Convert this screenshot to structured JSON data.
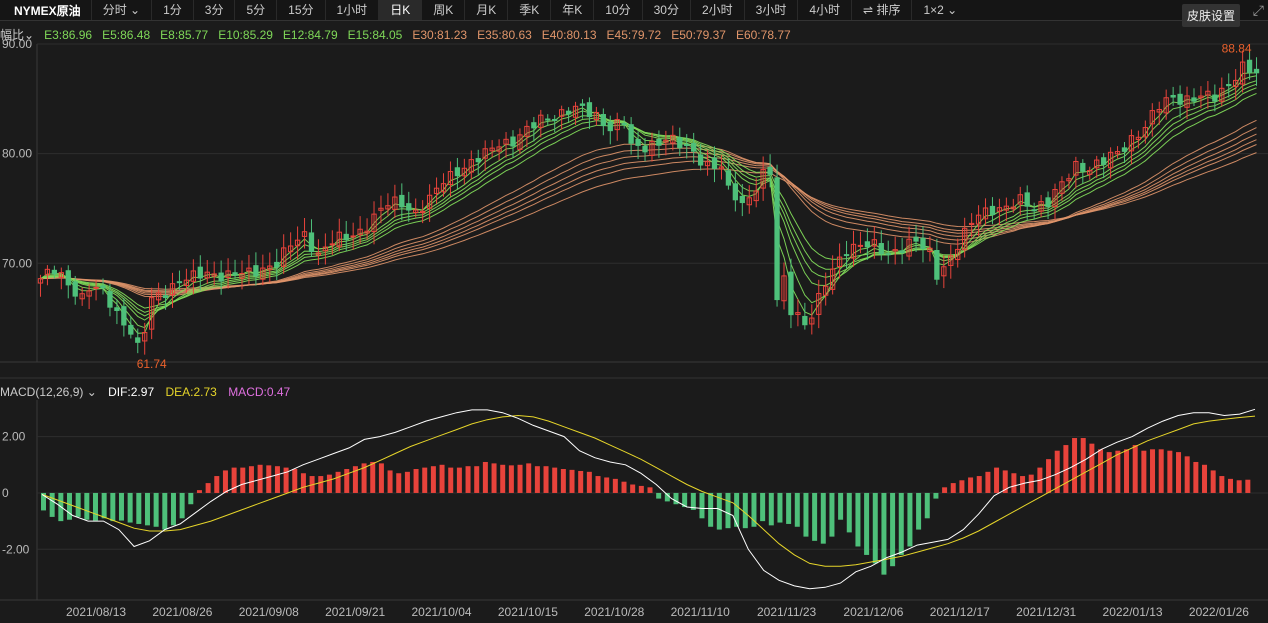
{
  "toolbar": {
    "symbol": "NYMEX原油",
    "timeshare": "分时 ⌄",
    "tabs": [
      "1分",
      "3分",
      "5分",
      "15分",
      "1小时",
      "日K",
      "周K",
      "月K",
      "季K",
      "年K",
      "10分",
      "30分",
      "2小时",
      "3小时",
      "4小时"
    ],
    "active": "日K",
    "sort": "排序",
    "layout": "1×2 ⌄",
    "skin": "皮肤设置"
  },
  "ema_legend": {
    "prefix": "幅比⌄",
    "items": [
      {
        "label": "E3:86.96",
        "color": "#7fd858"
      },
      {
        "label": "E5:86.48",
        "color": "#7fd858"
      },
      {
        "label": "E8:85.77",
        "color": "#7fd858"
      },
      {
        "label": "E10:85.29",
        "color": "#7fd858"
      },
      {
        "label": "E12:84.79",
        "color": "#7fd858"
      },
      {
        "label": "E15:84.05",
        "color": "#7fd858"
      },
      {
        "label": "E30:81.23",
        "color": "#e0956a"
      },
      {
        "label": "E35:80.63",
        "color": "#e0956a"
      },
      {
        "label": "E40:80.13",
        "color": "#e0956a"
      },
      {
        "label": "E45:79.72",
        "color": "#e0956a"
      },
      {
        "label": "E50:79.37",
        "color": "#e0956a"
      },
      {
        "label": "E60:78.77",
        "color": "#e0956a"
      }
    ]
  },
  "macd_legend": {
    "title": "MACD(12,26,9) ⌄",
    "dif": "DIF:2.97",
    "dea": "DEA:2.73",
    "macd": "MACD:0.47"
  },
  "colors": {
    "up": "#e8433b",
    "down": "#4ec07a",
    "dif": "#ffffff",
    "dea": "#e6d52a",
    "grid": "#2e2e2e",
    "annot": "#e8602c",
    "fast": "#7fd858",
    "slow": "#e0956a"
  },
  "chart_data": [
    {
      "type": "candlestick",
      "ylim": [
        61,
        90
      ],
      "yticks": [
        70,
        80,
        90
      ],
      "ytick_labels": [
        "70.00",
        "80.00",
        "90.00"
      ],
      "annotations": [
        {
          "text": "61.74",
          "value": 61.74,
          "at": "low"
        },
        {
          "text": "88.84",
          "value": 88.84,
          "at": "high"
        }
      ],
      "dates": [
        "2021/08/13",
        "2021/08/26",
        "2021/09/08",
        "2021/09/21",
        "2021/10/04",
        "2021/10/15",
        "2021/10/28",
        "2021/11/10",
        "2021/11/23",
        "2021/12/06",
        "2021/12/17",
        "2021/12/31",
        "2022/01/13",
        "2022/01/26"
      ],
      "close_path": [
        [
          0,
          68.6
        ],
        [
          2,
          69.2
        ],
        [
          4,
          68.2
        ],
        [
          6,
          67.0
        ],
        [
          7,
          67.8
        ],
        [
          9,
          67.2
        ],
        [
          11,
          65.5
        ],
        [
          13,
          64.0
        ],
        [
          14,
          62.3
        ],
        [
          15,
          63.8
        ],
        [
          16,
          66.5
        ],
        [
          18,
          67.5
        ],
        [
          20,
          68.6
        ],
        [
          22,
          68.6
        ],
        [
          24,
          69.0
        ],
        [
          26,
          69.1
        ],
        [
          28,
          69.0
        ],
        [
          30,
          68.9
        ],
        [
          32,
          69.6
        ],
        [
          34,
          70.2
        ],
        [
          36,
          71.5
        ],
        [
          38,
          72.5
        ],
        [
          40,
          71.0
        ],
        [
          42,
          72.0
        ],
        [
          44,
          72.2
        ],
        [
          46,
          73.0
        ],
        [
          48,
          74.3
        ],
        [
          50,
          75.3
        ],
        [
          52,
          75.5
        ],
        [
          54,
          74.8
        ],
        [
          56,
          75.7
        ],
        [
          58,
          77.4
        ],
        [
          60,
          78.6
        ],
        [
          62,
          79.2
        ],
        [
          64,
          79.8
        ],
        [
          66,
          81.0
        ],
        [
          68,
          81.3
        ],
        [
          70,
          82.0
        ],
        [
          72,
          83.0
        ],
        [
          74,
          83.6
        ],
        [
          76,
          84.0
        ],
        [
          78,
          83.9
        ],
        [
          80,
          83.5
        ],
        [
          82,
          82.5
        ],
        [
          84,
          82.8
        ],
        [
          85,
          80.5
        ],
        [
          86,
          80.5
        ],
        [
          88,
          81.0
        ],
        [
          90,
          81.3
        ],
        [
          92,
          80.7
        ],
        [
          94,
          80.3
        ],
        [
          96,
          79.0
        ],
        [
          98,
          78.6
        ],
        [
          99,
          76.5
        ],
        [
          100,
          76.2
        ],
        [
          101,
          75.5
        ],
        [
          102,
          76.2
        ],
        [
          104,
          78.0
        ],
        [
          105,
          78.1
        ],
        [
          106,
          66.5
        ],
        [
          107,
          68.5
        ],
        [
          108,
          66.0
        ],
        [
          109,
          65.5
        ],
        [
          110,
          64.5
        ],
        [
          111,
          65.2
        ],
        [
          112,
          66.5
        ],
        [
          114,
          69.5
        ],
        [
          116,
          71.5
        ],
        [
          118,
          71.5
        ],
        [
          120,
          71.5
        ],
        [
          122,
          71.0
        ],
        [
          124,
          71.5
        ],
        [
          126,
          71.8
        ],
        [
          128,
          71.0
        ],
        [
          129,
          69.2
        ],
        [
          131,
          70.5
        ],
        [
          133,
          72.5
        ],
        [
          135,
          74.7
        ],
        [
          137,
          75.1
        ],
        [
          139,
          74.8
        ],
        [
          141,
          75.7
        ],
        [
          143,
          75.3
        ],
        [
          145,
          75.6
        ],
        [
          147,
          77.0
        ],
        [
          149,
          79.0
        ],
        [
          151,
          78.8
        ],
        [
          153,
          79.2
        ],
        [
          155,
          80.0
        ],
        [
          157,
          81.5
        ],
        [
          159,
          82.4
        ],
        [
          161,
          84.2
        ],
        [
          163,
          85.3
        ],
        [
          165,
          85.0
        ],
        [
          167,
          85.0
        ],
        [
          169,
          85.2
        ],
        [
          171,
          86.5
        ],
        [
          173,
          87.8
        ],
        [
          175,
          87.1
        ]
      ],
      "ema_fast_last": [
        86.96,
        86.48,
        85.77,
        85.29,
        84.79,
        84.05
      ],
      "ema_slow_last": [
        81.23,
        80.63,
        80.13,
        79.72,
        79.37,
        78.77
      ]
    },
    {
      "type": "macd",
      "ylim": [
        -3.8,
        3.3
      ],
      "yticks": [
        -2,
        0,
        2
      ],
      "ytick_labels": [
        "-2.00",
        "0",
        "2.00"
      ],
      "hist": [
        -0.62,
        -0.85,
        -1.0,
        -0.95,
        -0.85,
        -0.95,
        -0.98,
        -0.9,
        -1.0,
        -0.98,
        -1.05,
        -1.1,
        -1.15,
        -1.2,
        -1.3,
        -1.15,
        -0.9,
        -0.4,
        0.1,
        0.35,
        0.6,
        0.8,
        0.9,
        0.9,
        0.95,
        1.0,
        0.98,
        0.95,
        0.9,
        0.85,
        0.7,
        0.6,
        0.6,
        0.65,
        0.75,
        0.85,
        0.95,
        1.05,
        1.1,
        1.05,
        0.8,
        0.7,
        0.75,
        0.85,
        0.9,
        0.95,
        1.0,
        0.9,
        0.9,
        0.95,
        0.95,
        1.1,
        1.05,
        1.0,
        0.98,
        1.0,
        1.05,
        0.95,
        0.95,
        0.9,
        0.85,
        0.82,
        0.78,
        0.75,
        0.6,
        0.55,
        0.5,
        0.4,
        0.3,
        0.25,
        0.2,
        -0.2,
        -0.3,
        -0.4,
        -0.5,
        -0.6,
        -0.9,
        -1.2,
        -1.3,
        -1.25,
        -1.2,
        -1.25,
        -1.2,
        -1.0,
        -1.15,
        -1.05,
        -1.1,
        -1.2,
        -1.55,
        -1.7,
        -1.8,
        -1.55,
        -0.95,
        -1.4,
        -1.9,
        -2.2,
        -2.5,
        -2.9,
        -2.6,
        -2.2,
        -1.9,
        -1.3,
        -0.9,
        -0.2,
        0.2,
        0.35,
        0.45,
        0.55,
        0.6,
        0.75,
        0.9,
        0.8,
        0.7,
        0.6,
        0.65,
        0.9,
        1.2,
        1.5,
        1.7,
        1.95,
        1.95,
        1.75,
        1.55,
        1.45,
        1.5,
        1.55,
        1.7,
        1.5,
        1.55,
        1.55,
        1.5,
        1.45,
        1.3,
        1.1,
        1.0,
        0.8,
        0.6,
        0.5,
        0.45,
        0.47
      ],
      "dif": [
        -0.05,
        -0.4,
        -0.8,
        -1.0,
        -1.0,
        -1.3,
        -1.9,
        -1.7,
        -1.3,
        -1.1,
        -0.7,
        -0.3,
        0.05,
        0.3,
        0.45,
        0.6,
        0.75,
        1.0,
        1.2,
        1.4,
        1.6,
        1.9,
        2.0,
        2.15,
        2.35,
        2.55,
        2.7,
        2.85,
        2.95,
        2.95,
        2.85,
        2.65,
        2.4,
        2.2,
        2.0,
        1.5,
        1.25,
        1.1,
        1.0,
        0.7,
        0.3,
        -0.2,
        -0.5,
        -0.55,
        -0.55,
        -0.8,
        -2.0,
        -2.75,
        -3.1,
        -3.3,
        -3.4,
        -3.35,
        -3.2,
        -2.8,
        -2.6,
        -2.3,
        -2.1,
        -1.85,
        -1.75,
        -1.65,
        -1.3,
        -0.75,
        -0.1,
        0.2,
        0.35,
        0.45,
        0.65,
        0.9,
        1.2,
        1.55,
        1.8,
        2.0,
        2.3,
        2.55,
        2.75,
        2.85,
        2.85,
        2.75,
        2.8,
        2.97
      ],
      "dea": [
        -0.05,
        -0.25,
        -0.45,
        -0.65,
        -0.85,
        -1.05,
        -1.25,
        -1.35,
        -1.35,
        -1.3,
        -1.15,
        -1.0,
        -0.8,
        -0.6,
        -0.4,
        -0.2,
        0.0,
        0.2,
        0.35,
        0.5,
        0.7,
        0.9,
        1.15,
        1.4,
        1.65,
        1.85,
        2.05,
        2.25,
        2.45,
        2.6,
        2.7,
        2.75,
        2.7,
        2.55,
        2.35,
        2.15,
        1.95,
        1.7,
        1.45,
        1.2,
        0.9,
        0.6,
        0.3,
        0.05,
        -0.15,
        -0.35,
        -0.8,
        -1.3,
        -1.8,
        -2.2,
        -2.5,
        -2.6,
        -2.6,
        -2.55,
        -2.45,
        -2.35,
        -2.25,
        -2.1,
        -1.95,
        -1.8,
        -1.6,
        -1.35,
        -1.05,
        -0.75,
        -0.45,
        -0.15,
        0.15,
        0.45,
        0.75,
        1.05,
        1.35,
        1.6,
        1.85,
        2.05,
        2.25,
        2.45,
        2.55,
        2.62,
        2.68,
        2.73
      ]
    }
  ]
}
